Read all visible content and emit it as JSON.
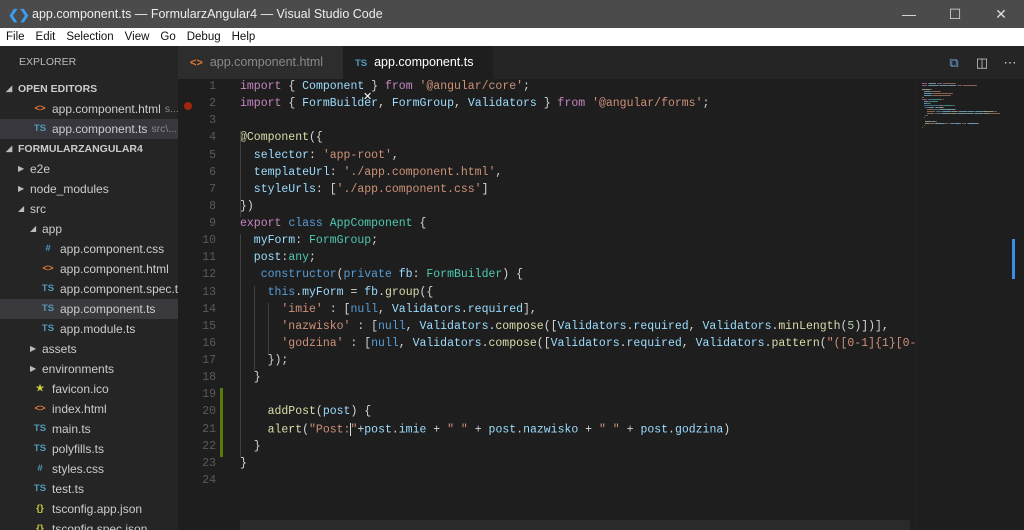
{
  "window": {
    "title": "app.component.ts — FormularzAngular4 — Visual Studio Code",
    "minimize": "—",
    "maximize": "☐",
    "close": "✕"
  },
  "menu": [
    "File",
    "Edit",
    "Selection",
    "View",
    "Go",
    "Debug",
    "Help"
  ],
  "sidebar": {
    "title": "EXPLORER",
    "open_editors_label": "OPEN EDITORS",
    "open_editors": [
      {
        "icon": "<>",
        "icon_type": "html",
        "name": "app.component.html",
        "path": "s..."
      },
      {
        "icon": "TS",
        "icon_type": "ts",
        "name": "app.component.ts",
        "path": "src\\..."
      }
    ],
    "project_label": "FORMULARZANGULAR4",
    "tree": [
      {
        "depth": 1,
        "twisty": "▶",
        "name": "e2e"
      },
      {
        "depth": 1,
        "twisty": "▶",
        "name": "node_modules"
      },
      {
        "depth": 1,
        "twisty": "◢",
        "name": "src"
      },
      {
        "depth": 2,
        "twisty": "◢",
        "name": "app"
      },
      {
        "depth": 3,
        "icon": "#",
        "icon_type": "css",
        "name": "app.component.css"
      },
      {
        "depth": 3,
        "icon": "<>",
        "icon_type": "html",
        "name": "app.component.html"
      },
      {
        "depth": 3,
        "icon": "TS",
        "icon_type": "ts",
        "name": "app.component.spec.ts"
      },
      {
        "depth": 3,
        "icon": "TS",
        "icon_type": "ts",
        "name": "app.component.ts",
        "selected": true
      },
      {
        "depth": 3,
        "icon": "TS",
        "icon_type": "ts",
        "name": "app.module.ts"
      },
      {
        "depth": 2,
        "twisty": "▶",
        "name": "assets"
      },
      {
        "depth": 2,
        "twisty": "▶",
        "name": "environments"
      },
      {
        "depth": 2,
        "icon": "★",
        "icon_type": "star",
        "name": "favicon.ico"
      },
      {
        "depth": 2,
        "icon": "<>",
        "icon_type": "html",
        "name": "index.html"
      },
      {
        "depth": 2,
        "icon": "TS",
        "icon_type": "ts",
        "name": "main.ts"
      },
      {
        "depth": 2,
        "icon": "TS",
        "icon_type": "ts",
        "name": "polyfills.ts"
      },
      {
        "depth": 2,
        "icon": "#",
        "icon_type": "css",
        "name": "styles.css"
      },
      {
        "depth": 2,
        "icon": "TS",
        "icon_type": "ts",
        "name": "test.ts"
      },
      {
        "depth": 2,
        "icon": "{}",
        "icon_type": "json",
        "name": "tsconfig.app.json"
      },
      {
        "depth": 2,
        "icon": "{}",
        "icon_type": "json",
        "name": "tsconfig.spec.json"
      }
    ]
  },
  "icon_colors": {
    "html": "#e37933",
    "ts": "#519aba",
    "css": "#519aba",
    "star": "#cbcb41",
    "json": "#cbcb41"
  },
  "tabs": [
    {
      "icon": "<>",
      "label": "app.component.html",
      "active": false
    },
    {
      "icon": "TS",
      "label": "app.component.ts",
      "active": true,
      "close": "✕"
    }
  ],
  "editor": {
    "breakpoint_line": 2,
    "modified_lines": [
      19,
      22
    ],
    "lines": [
      [
        [
          "import",
          "k"
        ],
        [
          " { ",
          "p"
        ],
        [
          "Component",
          "v"
        ],
        [
          " } ",
          "p"
        ],
        [
          "from",
          "k"
        ],
        [
          " ",
          "p"
        ],
        [
          "'@angular/core'",
          "s"
        ],
        [
          ";",
          "p"
        ]
      ],
      [
        [
          "import",
          "k"
        ],
        [
          " { ",
          "p"
        ],
        [
          "FormBuilder",
          "v"
        ],
        [
          ", ",
          "p"
        ],
        [
          "FormGroup",
          "v"
        ],
        [
          ", ",
          "p"
        ],
        [
          "Validators",
          "v"
        ],
        [
          " } ",
          "p"
        ],
        [
          "from",
          "k"
        ],
        [
          " ",
          "p"
        ],
        [
          "'@angular/forms'",
          "s"
        ],
        [
          ";",
          "p"
        ]
      ],
      [],
      [
        [
          "@Component",
          "f"
        ],
        [
          "({",
          "p"
        ]
      ],
      [
        [
          "  selector",
          "v"
        ],
        [
          ": ",
          "p"
        ],
        [
          "'app-root'",
          "s"
        ],
        [
          ",",
          "p"
        ]
      ],
      [
        [
          "  templateUrl",
          "v"
        ],
        [
          ": ",
          "p"
        ],
        [
          "'./app.component.html'",
          "s"
        ],
        [
          ",",
          "p"
        ]
      ],
      [
        [
          "  styleUrls",
          "v"
        ],
        [
          ": [",
          "p"
        ],
        [
          "'./app.component.css'",
          "s"
        ],
        [
          "]",
          "p"
        ]
      ],
      [
        [
          "})",
          "p"
        ]
      ],
      [
        [
          "export",
          "k"
        ],
        [
          " ",
          "p"
        ],
        [
          "class",
          "b"
        ],
        [
          " ",
          "p"
        ],
        [
          "AppComponent",
          "t"
        ],
        [
          " {",
          "p"
        ]
      ],
      [
        [
          "  myForm",
          "v"
        ],
        [
          ": ",
          "p"
        ],
        [
          "FormGroup",
          "t"
        ],
        [
          ";",
          "p"
        ]
      ],
      [
        [
          "  post",
          "v"
        ],
        [
          ":",
          "p"
        ],
        [
          "any",
          "t"
        ],
        [
          ";",
          "p"
        ]
      ],
      [
        [
          "   constructor",
          "b"
        ],
        [
          "(",
          "p"
        ],
        [
          "private",
          "b"
        ],
        [
          " ",
          "p"
        ],
        [
          "fb",
          "v"
        ],
        [
          ": ",
          "p"
        ],
        [
          "FormBuilder",
          "t"
        ],
        [
          ") {",
          "p"
        ]
      ],
      [
        [
          "    this",
          "b"
        ],
        [
          ".",
          "p"
        ],
        [
          "myForm",
          "v"
        ],
        [
          " = ",
          "p"
        ],
        [
          "fb",
          "v"
        ],
        [
          ".",
          "p"
        ],
        [
          "group",
          "f"
        ],
        [
          "({",
          "p"
        ]
      ],
      [
        [
          "      'imie'",
          "s"
        ],
        [
          " : [",
          "p"
        ],
        [
          "null",
          "b"
        ],
        [
          ", ",
          "p"
        ],
        [
          "Validators",
          "v"
        ],
        [
          ".",
          "p"
        ],
        [
          "required",
          "v"
        ],
        [
          "],",
          "p"
        ]
      ],
      [
        [
          "      'nazwisko'",
          "s"
        ],
        [
          " : [",
          "p"
        ],
        [
          "null",
          "b"
        ],
        [
          ", ",
          "p"
        ],
        [
          "Validators",
          "v"
        ],
        [
          ".",
          "p"
        ],
        [
          "compose",
          "f"
        ],
        [
          "([",
          "p"
        ],
        [
          "Validators",
          "v"
        ],
        [
          ".",
          "p"
        ],
        [
          "required",
          "v"
        ],
        [
          ", ",
          "p"
        ],
        [
          "Validators",
          "v"
        ],
        [
          ".",
          "p"
        ],
        [
          "minLength",
          "f"
        ],
        [
          "(",
          "p"
        ],
        [
          "5",
          "n"
        ],
        [
          ")])],",
          "p"
        ]
      ],
      [
        [
          "      'godzina'",
          "s"
        ],
        [
          " : [",
          "p"
        ],
        [
          "null",
          "b"
        ],
        [
          ", ",
          "p"
        ],
        [
          "Validators",
          "v"
        ],
        [
          ".",
          "p"
        ],
        [
          "compose",
          "f"
        ],
        [
          "([",
          "p"
        ],
        [
          "Validators",
          "v"
        ],
        [
          ".",
          "p"
        ],
        [
          "required",
          "v"
        ],
        [
          ", ",
          "p"
        ],
        [
          "Validators",
          "v"
        ],
        [
          ".",
          "p"
        ],
        [
          "pattern",
          "f"
        ],
        [
          "(",
          "p"
        ],
        [
          "\"([0-1]{1}[0-",
          "s"
        ]
      ],
      [
        [
          "    });",
          "p"
        ]
      ],
      [
        [
          "  }",
          "p"
        ]
      ],
      [],
      [
        [
          "    addPost",
          "f"
        ],
        [
          "(",
          "p"
        ],
        [
          "post",
          "v"
        ],
        [
          ") {",
          "p"
        ]
      ],
      [
        [
          "    alert",
          "f"
        ],
        [
          "(",
          "p"
        ],
        [
          "\"Post:",
          "s"
        ],
        [
          "|CARET|",
          "c"
        ],
        [
          "\"",
          "s"
        ],
        [
          "+",
          "p"
        ],
        [
          "post",
          "v"
        ],
        [
          ".",
          "p"
        ],
        [
          "imie",
          "v"
        ],
        [
          " + ",
          "p"
        ],
        [
          "\" \"",
          "s"
        ],
        [
          " + ",
          "p"
        ],
        [
          "post",
          "v"
        ],
        [
          ".",
          "p"
        ],
        [
          "nazwisko",
          "v"
        ],
        [
          " + ",
          "p"
        ],
        [
          "\" \"",
          "s"
        ],
        [
          " + ",
          "p"
        ],
        [
          "post",
          "v"
        ],
        [
          ".",
          "p"
        ],
        [
          "godzina",
          "v"
        ],
        [
          ")",
          "p"
        ]
      ],
      [
        [
          "  }",
          "p"
        ]
      ],
      [
        [
          "}",
          "p"
        ]
      ],
      []
    ]
  }
}
